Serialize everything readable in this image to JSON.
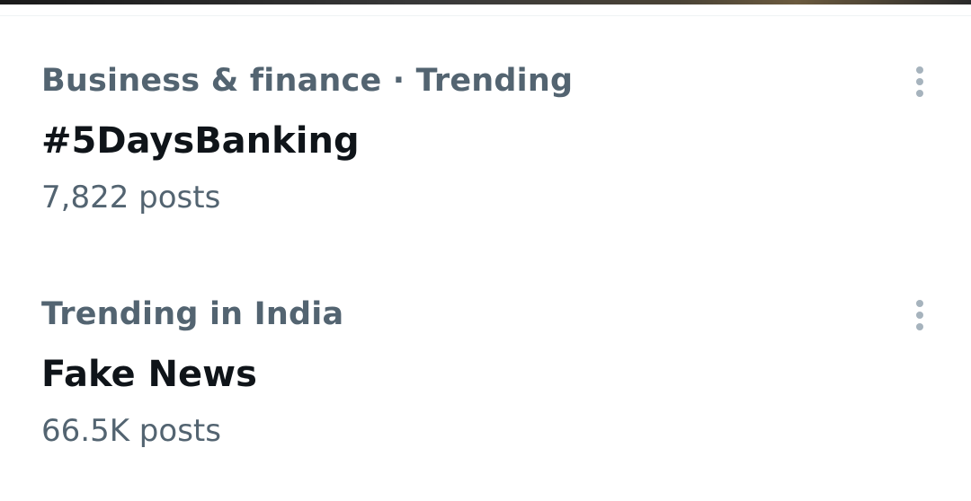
{
  "colors": {
    "context_text": "#536471",
    "title_text": "#0f1419",
    "more_icon": "#a6b3bd",
    "divider": "#eff3f4",
    "background": "#ffffff"
  },
  "trends": [
    {
      "context": "Business & finance · Trending",
      "title": "#5DaysBanking",
      "post_count": "7,822 posts",
      "more_icon": "more-vertical-icon"
    },
    {
      "context": "Trending in India",
      "title": "Fake News",
      "post_count": "66.5K posts",
      "more_icon": "more-vertical-icon"
    }
  ]
}
